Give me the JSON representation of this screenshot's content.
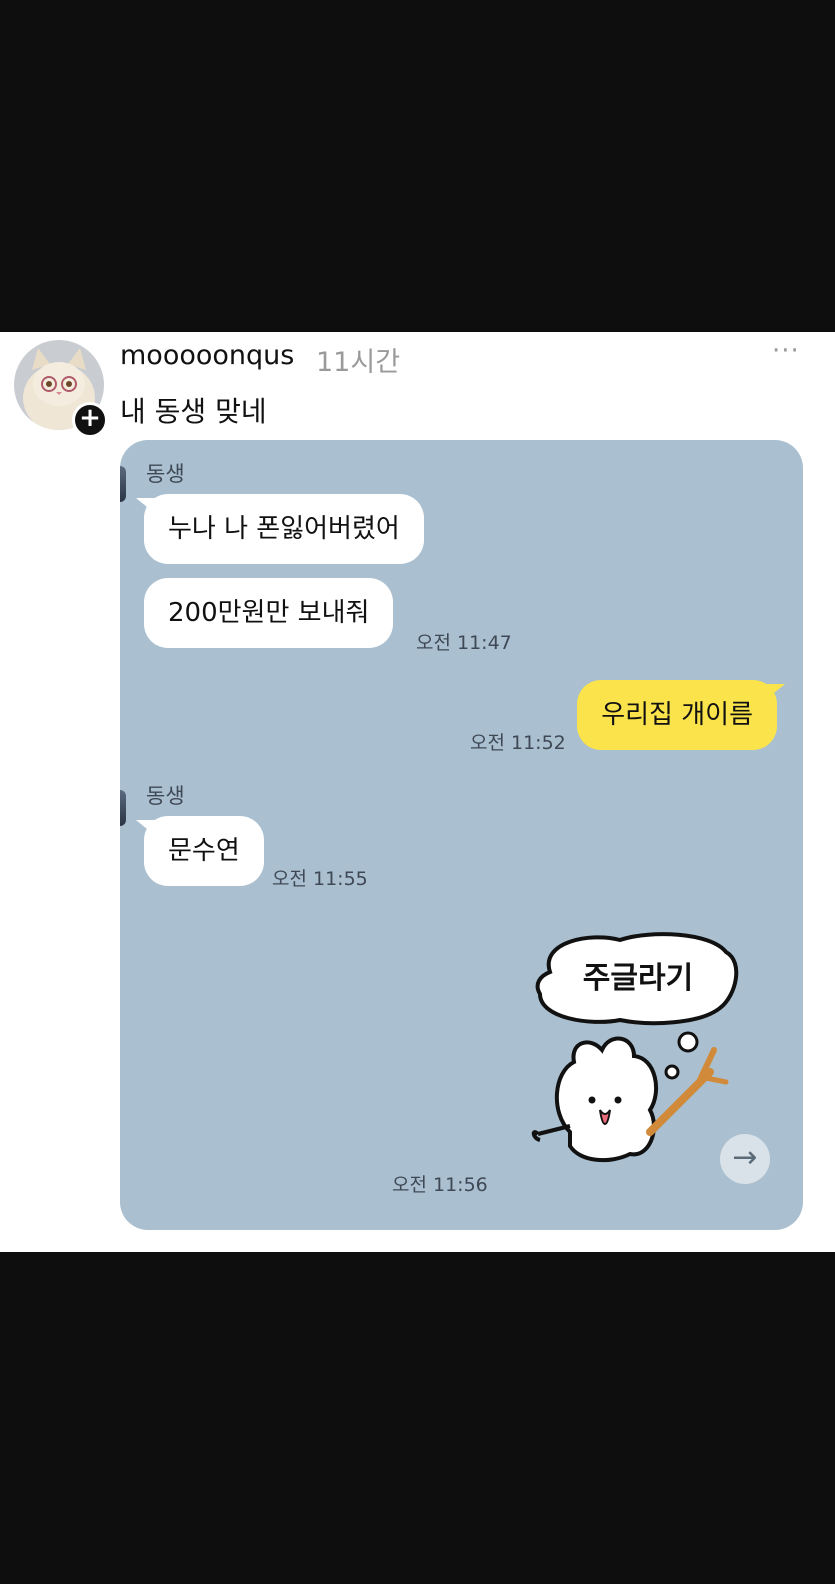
{
  "post": {
    "username": "mooooonqus",
    "time_ago": "11시간",
    "caption": "내 동생 맞네",
    "more_icon": "···",
    "avatar_icon": "cat-avatar-icon",
    "follow_icon": "+"
  },
  "chat": {
    "sender_name_1": "동생",
    "msg_1": "누나 나 폰잃어버렸어",
    "msg_2": "200만원만 보내줘",
    "ts_1": "오전 11:47",
    "reply": "우리집 개이름",
    "ts_2": "오전 11:52",
    "sender_name_2": "동생",
    "msg_3": "문수연",
    "ts_3": "오전 11:55",
    "sticker_text": "주글라기",
    "ts_4": "오전 11:56",
    "share_icon": "→"
  },
  "colors": {
    "chat_background": "#aabfcf",
    "my_bubble": "#fbe44b",
    "their_bubble": "#ffffff"
  }
}
